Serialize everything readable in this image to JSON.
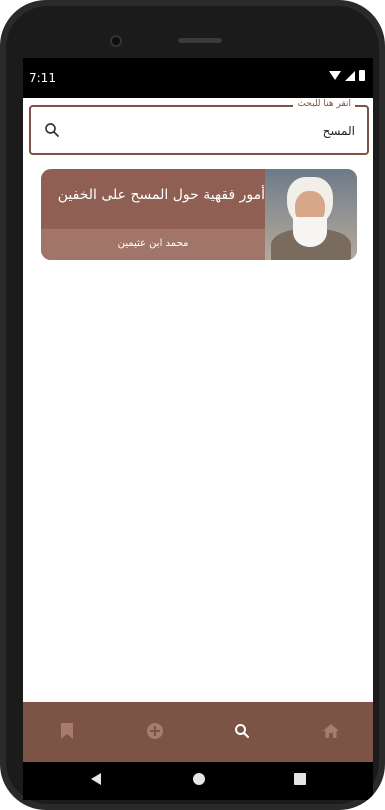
{
  "status_bar": {
    "time": "7:11"
  },
  "search": {
    "legend": "انقر هنا للبحث",
    "value": "المسح"
  },
  "results": [
    {
      "title": "أمور فقهية حول المسح على الخفين",
      "author": "محمد ابن عثيمين"
    }
  ],
  "bottom_nav": {
    "items": [
      {
        "icon": "bookmark-icon",
        "active": false
      },
      {
        "icon": "add-circle-icon",
        "active": false
      },
      {
        "icon": "search-icon",
        "active": true
      },
      {
        "icon": "home-icon",
        "active": false
      }
    ]
  },
  "colors": {
    "accent": "#7b5446",
    "card": "#8e5f52",
    "card_bottom": "#a17567",
    "nav_inactive": "#a77b6d",
    "nav_active": "#ffffff"
  }
}
